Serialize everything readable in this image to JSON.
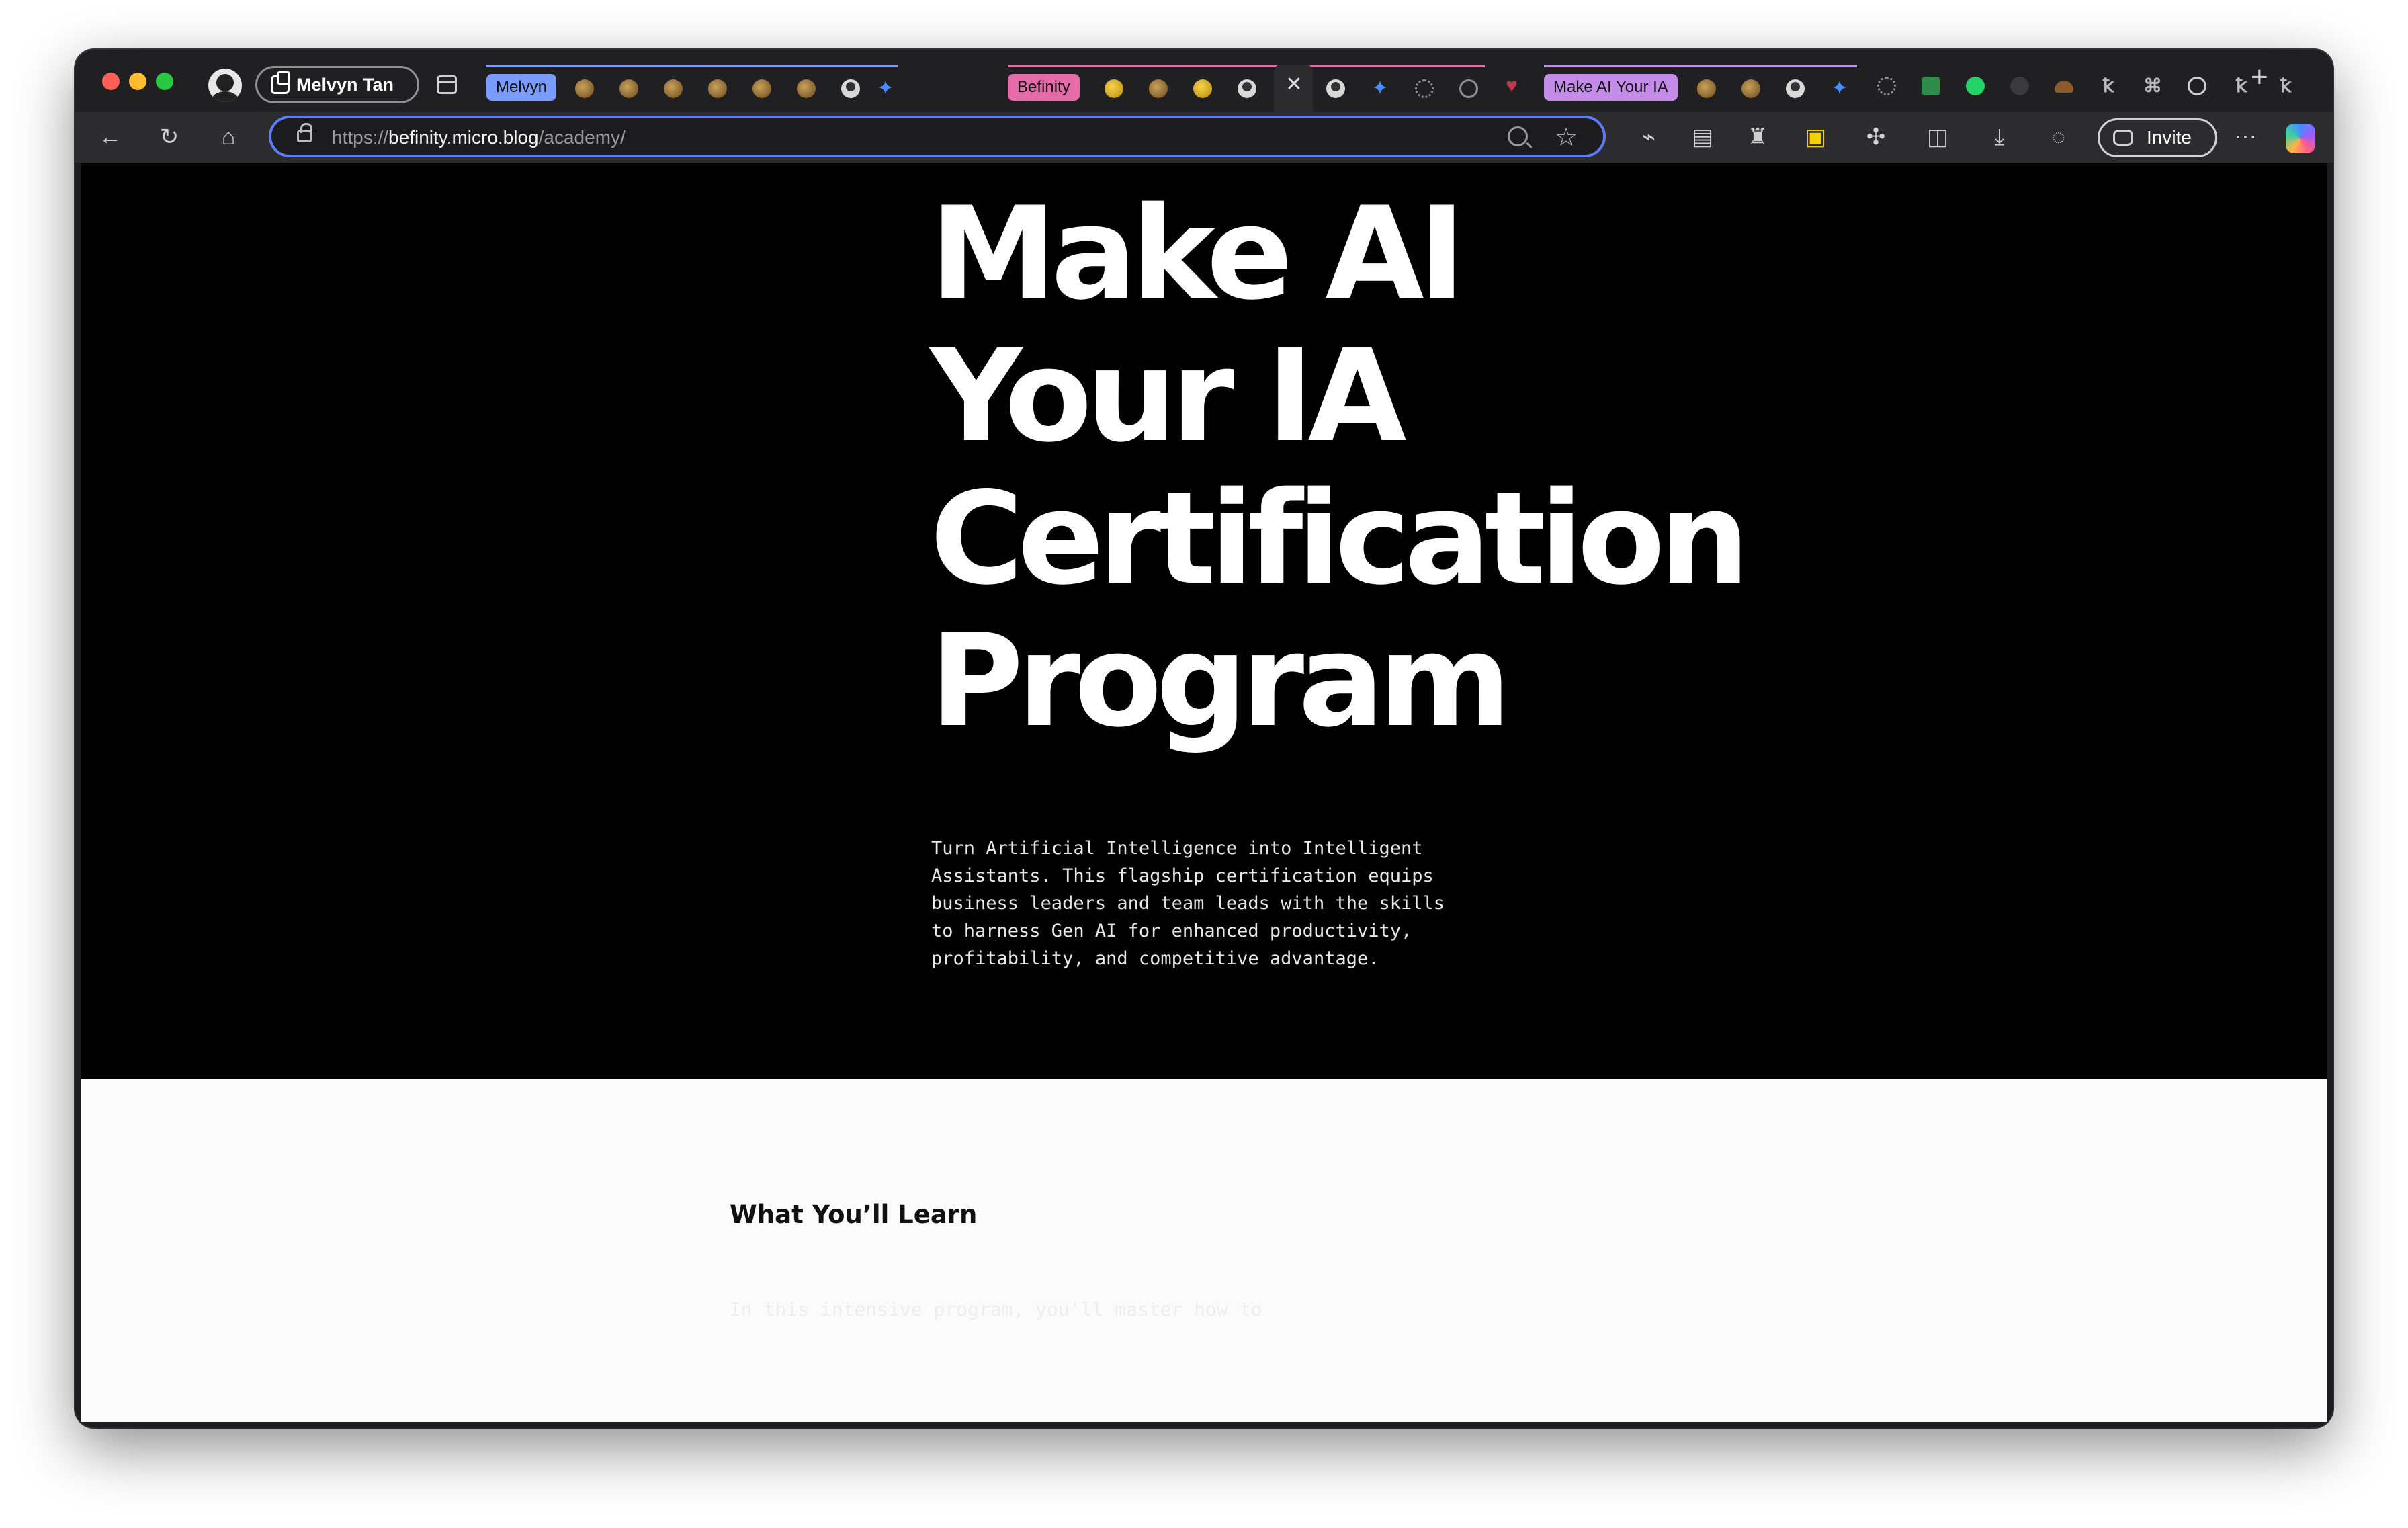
{
  "browser": {
    "profile_name": "Melvyn Tan",
    "tab_groups": [
      {
        "label": "Melvyn",
        "color": "#7b9cff"
      },
      {
        "label": "Befinity",
        "color": "#e46aa8"
      },
      {
        "label": "Make AI Your IA",
        "color": "#c48be8"
      }
    ],
    "url_scheme": "https://",
    "url_host": "befinity.micro.blog",
    "url_path": "/academy/",
    "invite_label": "Invite",
    "accent_color": "#5c7cfa"
  },
  "hero": {
    "title_lines": [
      "Make AI",
      "Your IA",
      "Certification",
      "Program"
    ],
    "description": "Turn Artificial Intelligence into Intelligent Assistants. This flagship certification equips business leaders and team leads with the skills to harness Gen AI for enhanced productivity, profitability, and competitive advantage."
  },
  "learn": {
    "title": "What You’ll Learn",
    "intro": "In this intensive program, you'll master how to"
  }
}
